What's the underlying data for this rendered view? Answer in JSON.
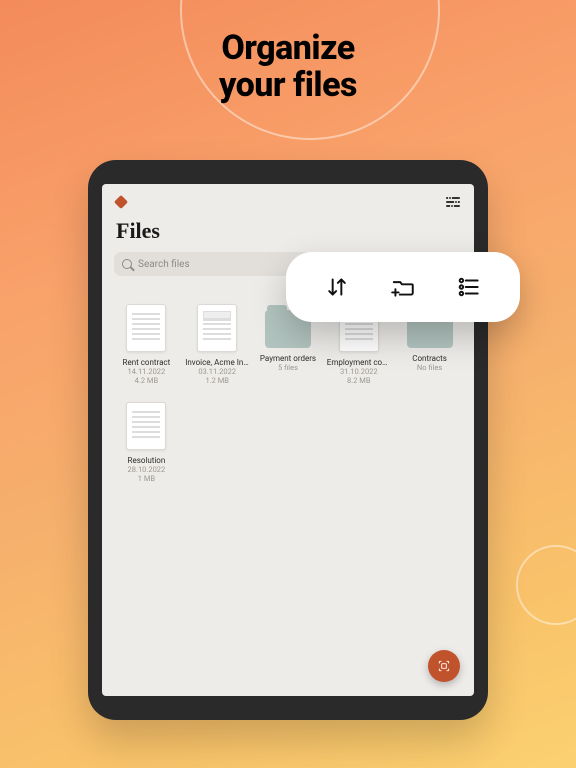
{
  "promo": {
    "title_line1": "Organize",
    "title_line2": "your files"
  },
  "screen": {
    "heading": "Files",
    "search_placeholder": "Search files"
  },
  "files": [
    {
      "kind": "doc",
      "name": "Rent contract",
      "date": "14.11.2022",
      "size": "4.2 MB"
    },
    {
      "kind": "doc",
      "name": "Invoice, Acme Inc.",
      "date": "03.11.2022",
      "size": "1.2 MB"
    },
    {
      "kind": "folder",
      "name": "Payment orders",
      "date": "5 files",
      "size": ""
    },
    {
      "kind": "doc",
      "name": "Employment contract",
      "date": "31.10.2022",
      "size": "8.2 MB"
    },
    {
      "kind": "folder",
      "name": "Contracts",
      "date": "No files",
      "size": ""
    },
    {
      "kind": "doc",
      "name": "Resolution",
      "date": "28.10.2022",
      "size": "1 MB"
    }
  ],
  "popover": {
    "sort": "Sort",
    "new_folder": "New folder",
    "view_options": "View options"
  },
  "fab": {
    "label": "Scan"
  },
  "colors": {
    "accent": "#c1532c"
  }
}
